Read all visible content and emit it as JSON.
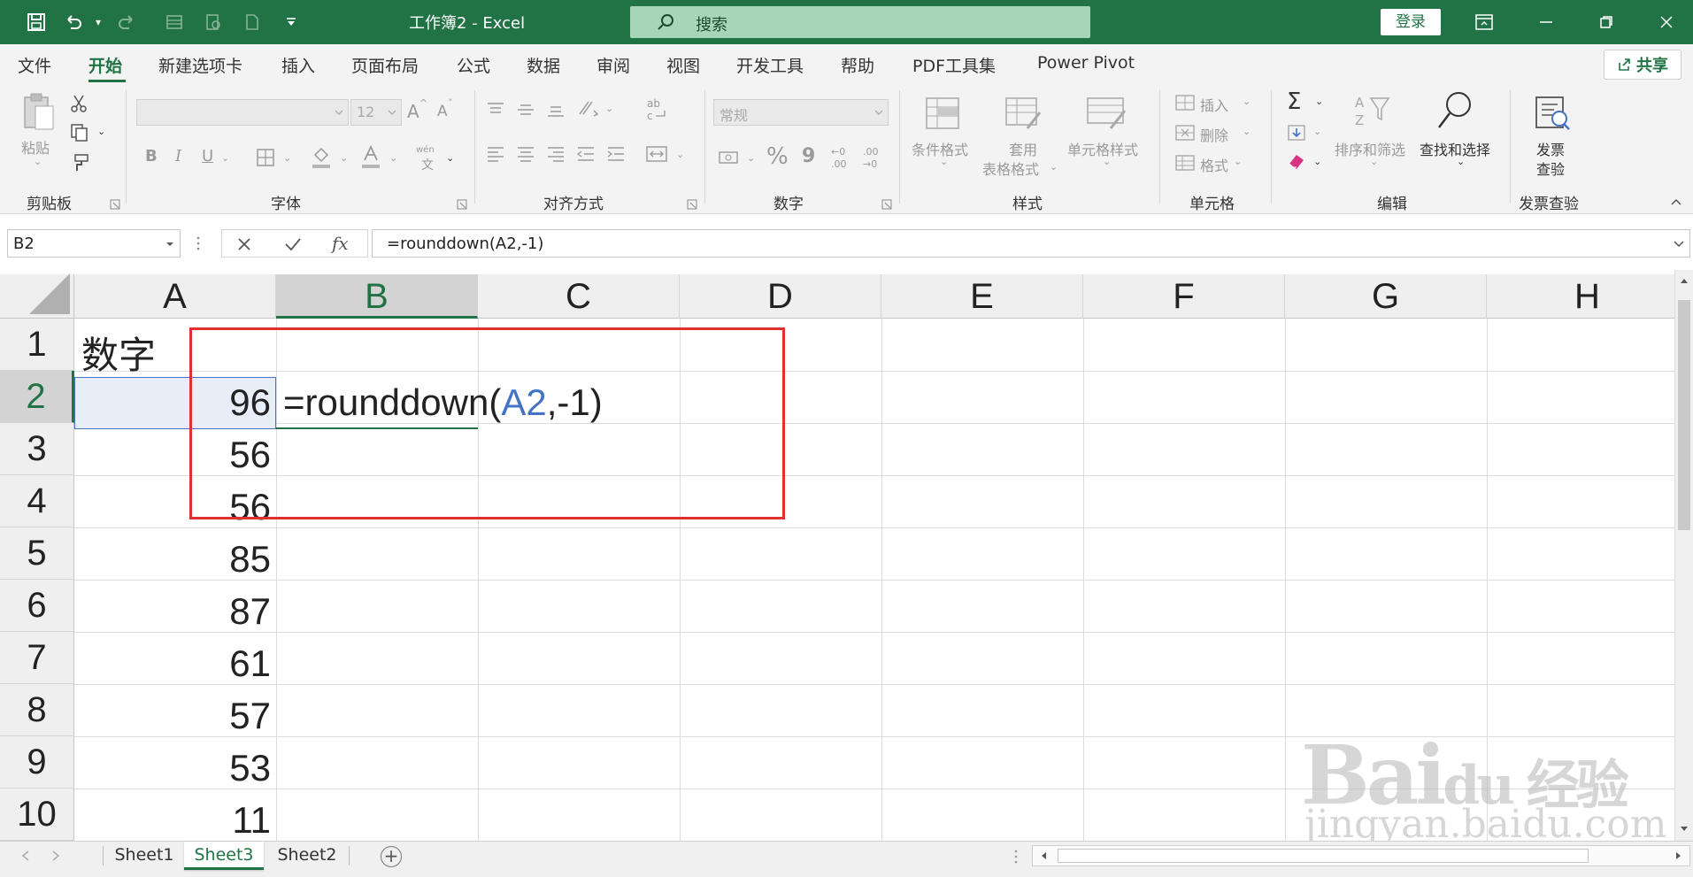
{
  "titlebar": {
    "doc_title": "工作簿2  -  Excel",
    "search_placeholder": "搜索",
    "login_label": "登录"
  },
  "menu": {
    "tabs": [
      "文件",
      "开始",
      "新建选项卡",
      "插入",
      "页面布局",
      "公式",
      "数据",
      "审阅",
      "视图",
      "开发工具",
      "帮助",
      "PDF工具集",
      "Power Pivot"
    ],
    "active_tab": "开始",
    "share_label": "共享"
  },
  "ribbon": {
    "clipboard": {
      "paste_label": "粘贴",
      "group_label": "剪贴板"
    },
    "font": {
      "font_size": "12",
      "bold": "B",
      "italic": "I",
      "underline": "U",
      "grow": "A",
      "shrink": "A",
      "phonetic": "wén",
      "group_label": "字体"
    },
    "alignment": {
      "group_label": "对齐方式"
    },
    "number": {
      "format_value": "常规",
      "percent": "%",
      "comma": "9",
      "group_label": "数字"
    },
    "styles": {
      "conditional": "条件格式",
      "table_format_1": "套用",
      "table_format_2": "表格格式",
      "cell_styles": "单元格样式",
      "group_label": "样式"
    },
    "cells": {
      "insert": "插入",
      "delete": "删除",
      "format": "格式",
      "group_label": "单元格"
    },
    "editing": {
      "sigma": "Σ",
      "sort_filter": "排序和筛选",
      "find_select": "查找和选择",
      "group_label": "编辑"
    },
    "invoice": {
      "label_1": "发票",
      "label_2": "查验",
      "group_label": "发票查验"
    }
  },
  "formula_bar": {
    "name_box": "B2",
    "fx": "fx",
    "formula": "=rounddown(A2,-1)"
  },
  "grid": {
    "columns": [
      "A",
      "B",
      "C",
      "D",
      "E",
      "F",
      "G",
      "H"
    ],
    "selected_column": "B",
    "rows": [
      "1",
      "2",
      "3",
      "4",
      "5",
      "6",
      "7",
      "8",
      "9",
      "10"
    ],
    "selected_row": "2",
    "a1": "数字",
    "values": [
      "96",
      "56",
      "56",
      "85",
      "87",
      "61",
      "57",
      "53",
      "11"
    ],
    "b2_prefix": "=rounddown(",
    "b2_ref": "A2",
    "b2_suffix": ",-1)"
  },
  "sheets": {
    "tabs": [
      "Sheet1",
      "Sheet3",
      "Sheet2"
    ],
    "active": "Sheet3"
  },
  "watermark": {
    "logo": "Bai",
    "logo_tail": "du 经验",
    "url": "jingyan.baidu.com"
  },
  "colors": {
    "excel_green": "#217346",
    "highlight_red": "#e03131",
    "reference_blue": "#4472c4"
  }
}
